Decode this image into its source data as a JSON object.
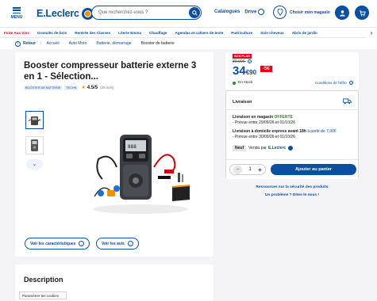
{
  "header": {
    "menu_label": "MENU",
    "logo_text": "E.Leclerc",
    "search_placeholder": "Que recherchez-vous ?",
    "catalogues_label": "Catalogues",
    "drive_label": "Drive",
    "store_label": "Choisir mon magasin"
  },
  "categories": [
    "Foire Aux Vins",
    "Granulés de bois",
    "Rentrée des Classes",
    "Literie Emma",
    "Chauffage",
    "Agendas et cahiers de texte",
    "Puériculture",
    "Soin cheveux",
    "Abris de jardin"
  ],
  "breadcrumb": {
    "back_label": "Retour",
    "items": [
      "Accueil",
      "Auto Moto",
      "Batterie, démarrage"
    ],
    "current": "Booster de batterie"
  },
  "product": {
    "title": "Booster compresseur batterie externe 3 en 1 - Sélection...",
    "tag1": "BOOSTER DE BATTERIE",
    "tag2": "TECHN",
    "rating": "4.5/5",
    "reviews": "(39 avis)",
    "features_button": "Voir les caractéristiques",
    "reviews_button": "Voir les avis"
  },
  "price": {
    "promo_badge": "BON PLAN",
    "old_price": "39,90€",
    "price_main": "34",
    "price_cents": "€90",
    "discount": "-5€",
    "stock": "En stock",
    "conditions": "Conditions de l'offre"
  },
  "delivery": {
    "heading": "Livraison",
    "store_line": "Livraison en magasin",
    "store_offer": "OFFERTE",
    "store_dates": "- Prévue entre 29/09/26 et 01/10/26",
    "home_line": "Livraison à domicile express avant 18h",
    "home_price": "à partir de 7,90€",
    "home_dates": "- Prévue entre 30/09/26 et 01/10/26",
    "condition": "Neuf",
    "sold_by": "Vendu par",
    "seller": "E.Leclerc",
    "qty": "1",
    "add_to_cart": "Ajouter au panier"
  },
  "links": {
    "safety": "Ressources sur la sécurité des produits",
    "problem": "Un problème ? Dites-le nous !"
  },
  "description": {
    "title": "Description"
  },
  "cookie": {
    "label": "Paramétrer les cookies"
  },
  "colors": {
    "brand_blue": "#0a4fa0",
    "accent_orange": "#f39200",
    "promo_red": "#e2001a",
    "stock_green": "#2e8b2e"
  }
}
